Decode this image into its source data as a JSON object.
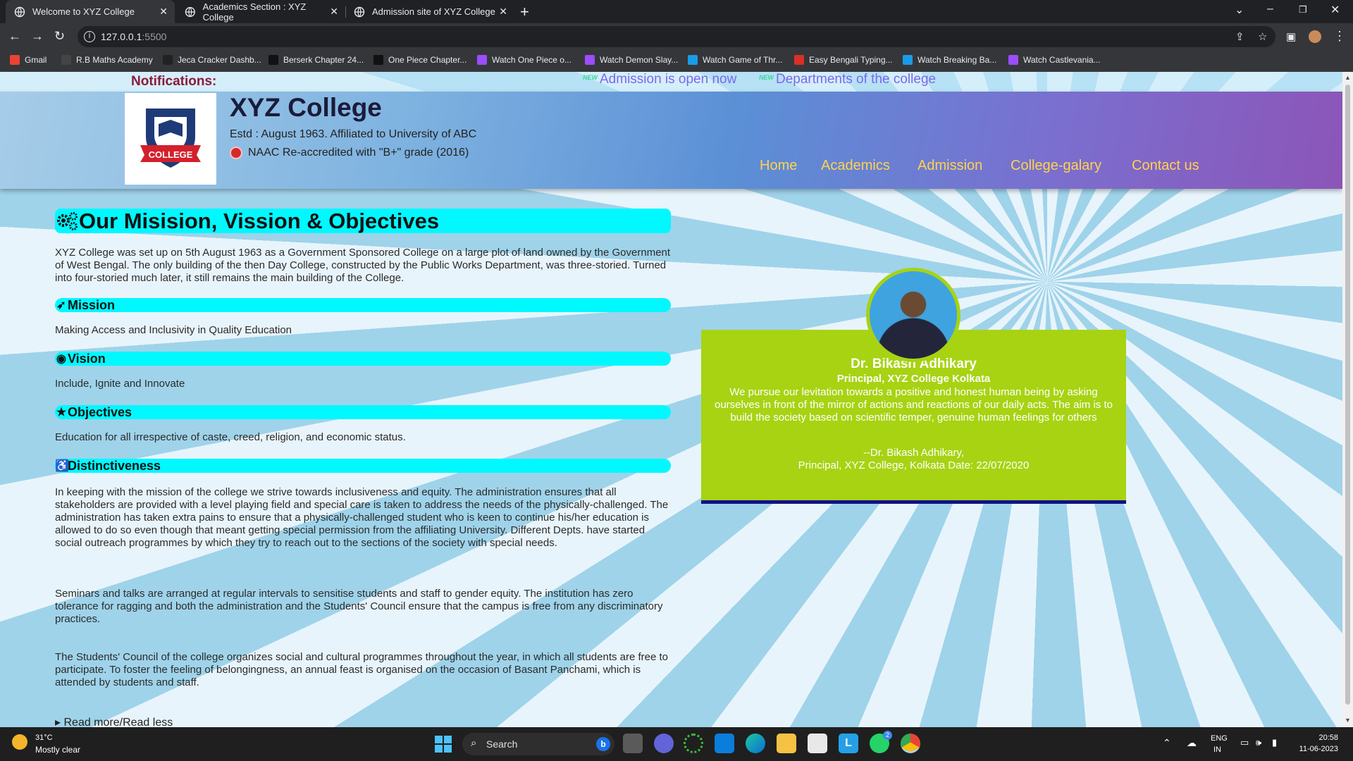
{
  "browser": {
    "tabs": [
      {
        "title": "Welcome to XYZ College",
        "active": true
      },
      {
        "title": "Academics Section : XYZ College",
        "active": false
      },
      {
        "title": "Admission site of XYZ College",
        "active": false
      }
    ],
    "url_host": "127.0.0.1",
    "url_port": ":5500",
    "bookmarks": [
      {
        "label": "Gmail",
        "icon": "gmail-icon",
        "color": "#ea4335"
      },
      {
        "label": "R.B Maths Academy",
        "icon": "tc-icon",
        "color": "#444444"
      },
      {
        "label": "Jeca Cracker Dashb...",
        "icon": "circle-icon",
        "color": "#222222"
      },
      {
        "label": "Berserk Chapter 24...",
        "icon": "mc-icon",
        "color": "#111111"
      },
      {
        "label": "One Piece Chapter...",
        "icon": "mc-icon",
        "color": "#111111"
      },
      {
        "label": "Watch One Piece o...",
        "icon": "play-icon",
        "color": "#9b4dff"
      },
      {
        "label": "Watch Demon Slay...",
        "icon": "play-icon",
        "color": "#9b4dff"
      },
      {
        "label": "Watch Game of Thr...",
        "icon": "ring-icon",
        "color": "#1a9be6"
      },
      {
        "label": "Easy Bengali Typing...",
        "icon": "red-icon",
        "color": "#d93025"
      },
      {
        "label": "Watch Breaking Ba...",
        "icon": "ring-icon",
        "color": "#1a9be6"
      },
      {
        "label": "Watch Castlevania...",
        "icon": "play-icon",
        "color": "#9b4dff"
      }
    ]
  },
  "notifications": {
    "label": "Notifications:",
    "badge": "NEW",
    "items": [
      "Admission is open now",
      "Departments of the college"
    ]
  },
  "header": {
    "logo_text": "COLLEGE",
    "college_name": "XYZ College",
    "estd": "Estd : August 1963. Affiliated to University of ABC",
    "naac": "NAAC Re-accredited with \"B+\" grade (2016)",
    "nav": [
      "Home",
      "Academics",
      "Admission",
      "College-galary",
      "Contact us"
    ]
  },
  "content": {
    "title": "Our Misision, Vission & Objectives",
    "intro": "XYZ College was set up on 5th August 1963 as a Government Sponsored College on a large plot of land owned by the Government of West Bengal. The only building of the then Day College, constructed by the Public Works Department, was three-storied. Turned into four-storied much later, it still remains the main building of the College.",
    "mission_title": "Mission",
    "mission_text": "Making Access and Inclusivity in Quality Education",
    "vision_title": "Vision",
    "vision_text": "Include, Ignite and Innovate",
    "objectives_title": "Objectives",
    "objectives_text": "Education for all irrespective of caste, creed, religion, and economic status.",
    "distinct_title": "Distinctiveness",
    "distinct_p1": "In keeping with the mission of the college we strive towards inclusiveness and equity. The administration ensures that all stakeholders are provided with a level playing field and special care is taken to address the needs of the physically-challenged. The administration has taken extra pains to ensure that a physically-challenged student who is keen to continue his/her education is allowed to do so even though that meant getting special permission from the affiliating University. Different Depts. have started social outreach programmes by which they try to reach out to the sections of the society with special needs.",
    "distinct_p2": "Seminars and talks are arranged at regular intervals to sensitise students and staff to gender equity. The institution has zero tolerance for ragging and both the administration and the Students' Council ensure that the campus is free from any discriminatory practices.",
    "distinct_p3": "The Students' Council of the college organizes social and cultural programmes throughout the year, in which all students are free to participate. To foster the feeling of belongingness, an annual feast is organised on the occasion of Basant Panchami, which is attended by students and staff.",
    "read_more": "Read more/Read less"
  },
  "principal": {
    "name": "Dr. Bikash Adhikary",
    "role": "Principal, XYZ College Kolkata",
    "quote": "We pursue our levitation towards a positive and honest human being by asking ourselves in front of the mirror of actions and reactions of our daily acts. The aim is to build the society based on scientific temper, genuine human feelings for others",
    "sign_line1": "--Dr. Bikash Adhikary,",
    "sign_line2": "Principal, XYZ College, Kolkata Date: 22/07/2020"
  },
  "taskbar": {
    "temp": "31°C",
    "weather": "Mostly clear",
    "search": "Search",
    "lang1": "ENG",
    "lang2": "IN",
    "time": "20:58",
    "date": "11-06-2023",
    "whatsapp_badge": "2"
  }
}
